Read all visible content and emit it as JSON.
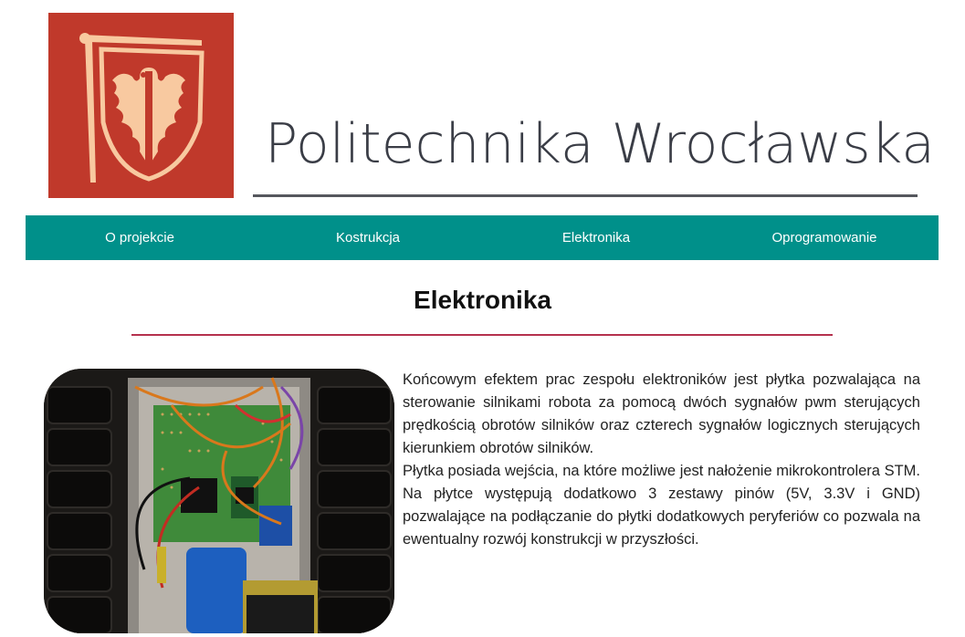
{
  "header": {
    "brand_name": "Politechnika Wrocławska",
    "logo_color": "#c0392b",
    "logo_accent": "#f8c9a0"
  },
  "nav": {
    "color": "#00908a",
    "items": [
      {
        "label": "O projekcie"
      },
      {
        "label": "Kostrukcja"
      },
      {
        "label": "Elektronika"
      },
      {
        "label": "Oprogramowanie"
      }
    ]
  },
  "main": {
    "title": "Elektronika",
    "rule_color": "#b5314e",
    "paragraphs": [
      "Końcowym efektem prac zespołu elektroników jest płytka pozwalająca na sterowanie silnikami robota za pomocą dwóch sygnałów pwm sterujących prędkością obrotów silników oraz czterech sygnałów logicznych sterujących kierunkiem obrotów silników.",
      "Płytka posiada wejścia, na które możliwe jest nałożenie mikrokontrolera STM. Na płytce występują dodatkowo 3 zestawy pinów (5V, 3.3V i GND) pozwalające na podłączanie do płytki dodatkowych peryferiów co pozwala na ewentualny rozwój konstrukcji w przyszłości."
    ]
  }
}
